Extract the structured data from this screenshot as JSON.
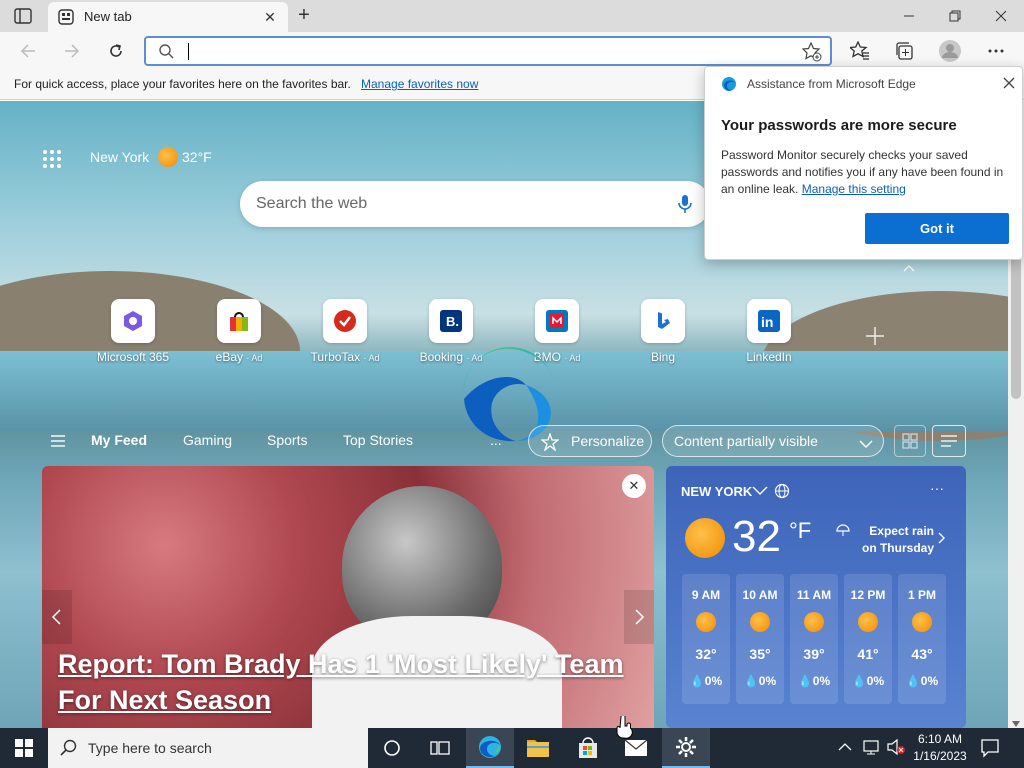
{
  "tab": {
    "title": "New tab"
  },
  "address": {
    "value": ""
  },
  "favorites_bar": {
    "text": "For quick access, place your favorites here on the favorites bar.",
    "link": "Manage favorites now"
  },
  "weather_header": {
    "location": "New York",
    "temp": "32°F"
  },
  "search": {
    "placeholder": "Search the web"
  },
  "quick_links": [
    {
      "name": "Microsoft 365",
      "ad": ""
    },
    {
      "name": "eBay",
      "ad": "· Ad"
    },
    {
      "name": "TurboTax",
      "ad": "· Ad"
    },
    {
      "name": "Booking",
      "ad": "· Ad"
    },
    {
      "name": "BMO",
      "ad": "· Ad"
    },
    {
      "name": "Bing",
      "ad": ""
    },
    {
      "name": "LinkedIn",
      "ad": ""
    }
  ],
  "feed_nav": {
    "my_feed": "My Feed",
    "gaming": "Gaming",
    "sports": "Sports",
    "top_stories": "Top Stories",
    "more": "...",
    "personalize": "Personalize",
    "content_visibility": "Content partially visible"
  },
  "news": {
    "headline": "Report: Tom Brady Has 1 'Most Likely' Team For Next Season"
  },
  "weather_card": {
    "location": "NEW YORK",
    "temp": "32",
    "unit": "°F",
    "forecast": "Expect rain on Thursday",
    "more": "···",
    "hours": [
      {
        "time": "9 AM",
        "temp": "32°",
        "precip": "0%"
      },
      {
        "time": "10 AM",
        "temp": "35°",
        "precip": "0%"
      },
      {
        "time": "11 AM",
        "temp": "39°",
        "precip": "0%"
      },
      {
        "time": "12 PM",
        "temp": "41°",
        "precip": "0%"
      },
      {
        "time": "1 PM",
        "temp": "43°",
        "precip": "0%"
      }
    ]
  },
  "popup": {
    "header": "Assistance from Microsoft Edge",
    "title": "Your passwords are more secure",
    "body": "Password Monitor securely checks your saved passwords and notifies you if any have been found in an online leak.",
    "link": "Manage this setting",
    "button": "Got it"
  },
  "taskbar": {
    "search_placeholder": "Type here to search",
    "time": "6:10 AM",
    "date": "1/16/2023"
  }
}
